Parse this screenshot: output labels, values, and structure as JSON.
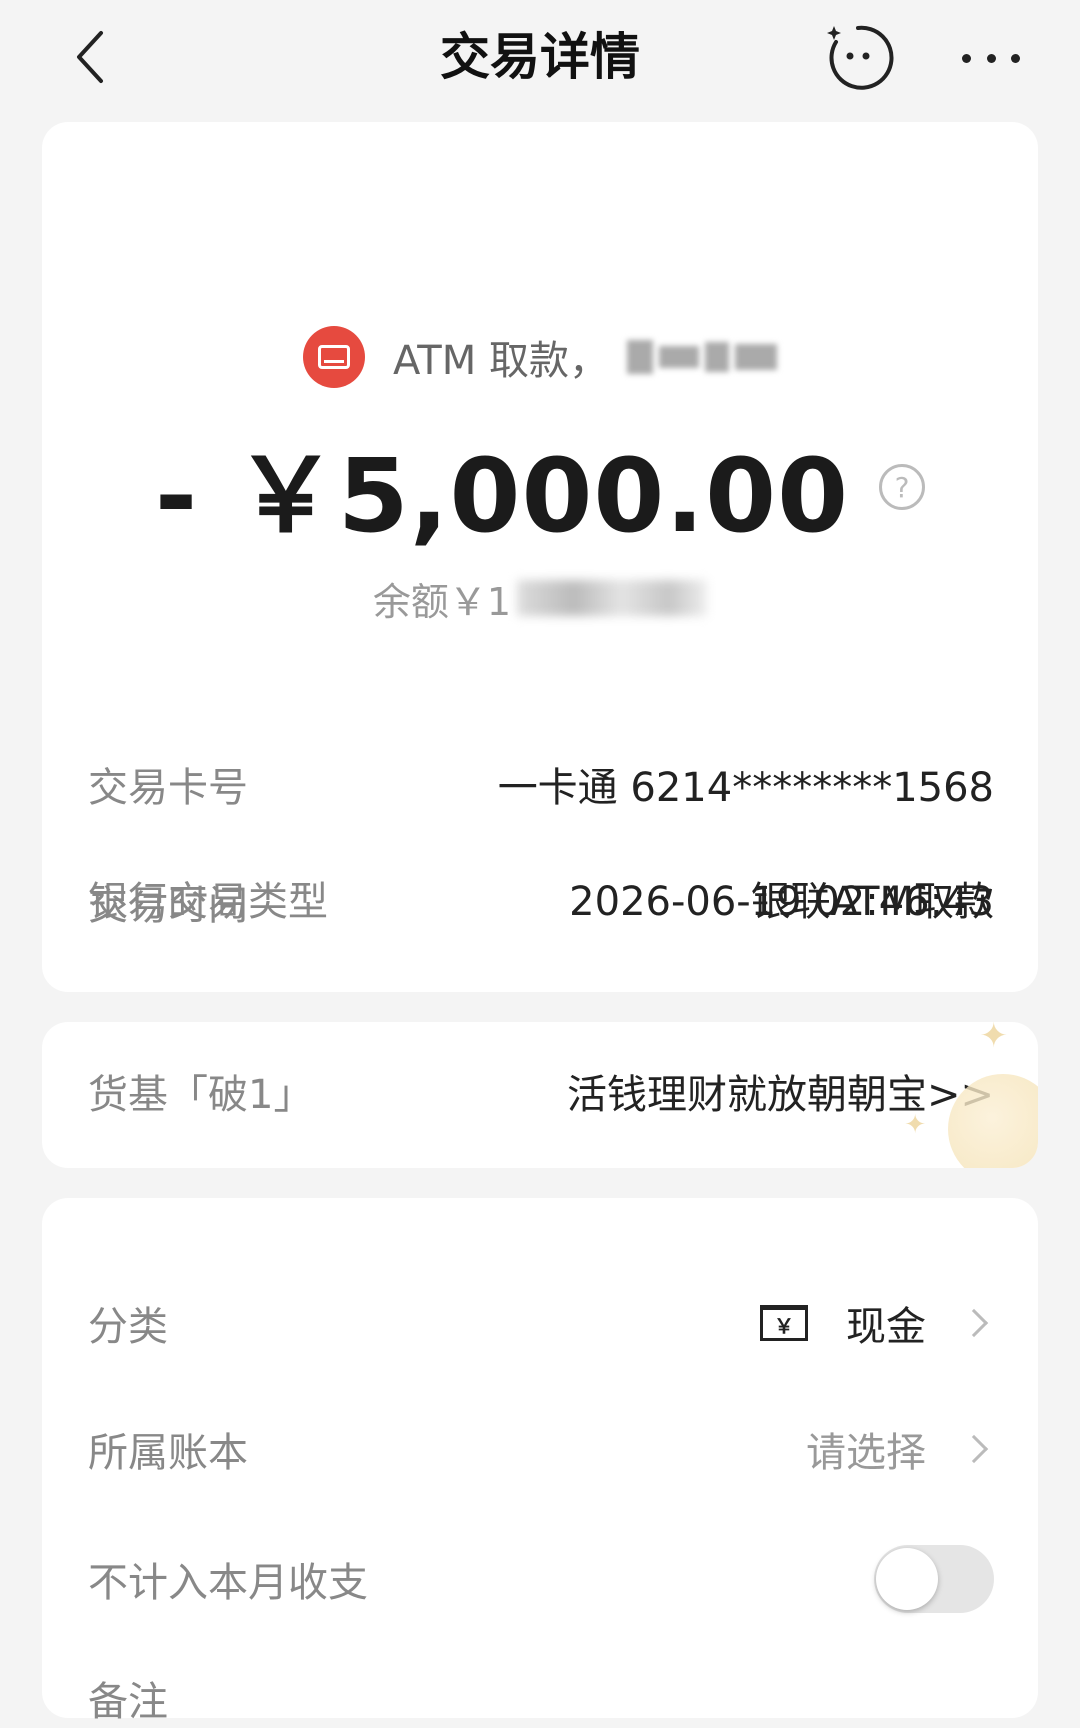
{
  "header": {
    "title": "交易详情",
    "back_icon": "chevron-left-icon",
    "bot_icon": "assistant-face-icon",
    "more_icon": "more-horizontal-icon"
  },
  "transaction": {
    "merchant_label": "ATM 取款，",
    "merchant_icon": "card-icon",
    "amount": "- ￥5,000.00",
    "balance_label": "余额￥1",
    "details": [
      {
        "label": "交易卡号",
        "value": "一卡通 6214********1568"
      },
      {
        "label": "交易时间",
        "value": "2026-06-19 02:46:43"
      },
      {
        "label": "银行交易类型",
        "value": "银联ATM取款"
      }
    ]
  },
  "promo": {
    "label": "货基「破1」",
    "link": "活钱理财就放朝朝宝>>"
  },
  "settings": {
    "category_label": "分类",
    "category_value": "现金",
    "category_icon_glyph": "￥",
    "book_label": "所属账本",
    "book_value": "请选择",
    "exclude_label": "不计入本月收支",
    "exclude_enabled": false,
    "note_label": "备注"
  },
  "colors": {
    "accent_red": "#e64a3f",
    "background": "#f4f4f4"
  }
}
